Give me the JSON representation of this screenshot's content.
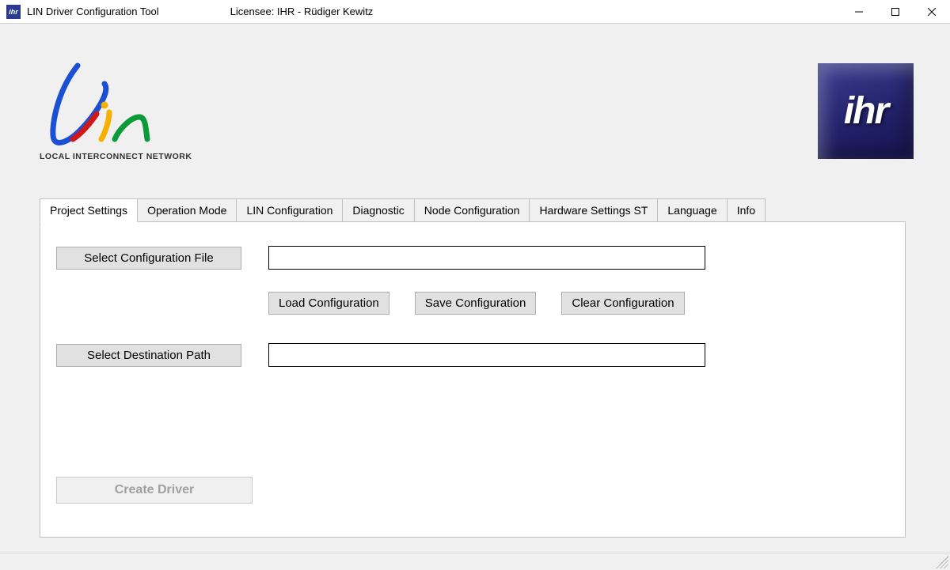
{
  "window": {
    "title": "LIN Driver Configuration Tool",
    "licensee": "Licensee:  IHR - Rüdiger Kewitz",
    "app_icon_text": "ihr"
  },
  "logos": {
    "lin_tagline": "LOCAL INTERCONNECT NETWORK",
    "ihr_text": "ihr"
  },
  "tabs": {
    "items": [
      {
        "label": "Project Settings",
        "selected": true
      },
      {
        "label": "Operation Mode",
        "selected": false
      },
      {
        "label": "LIN Configuration",
        "selected": false
      },
      {
        "label": "Diagnostic",
        "selected": false
      },
      {
        "label": "Node Configuration",
        "selected": false
      },
      {
        "label": "Hardware Settings ST",
        "selected": false
      },
      {
        "label": "Language",
        "selected": false
      },
      {
        "label": "Info",
        "selected": false
      }
    ]
  },
  "project_settings": {
    "select_config_btn": "Select Configuration File",
    "config_file_value": "",
    "load_btn": "Load Configuration",
    "save_btn": "Save Configuration",
    "clear_btn": "Clear Configuration",
    "select_dest_btn": "Select Destination Path",
    "dest_path_value": "",
    "create_driver_btn": "Create Driver"
  }
}
